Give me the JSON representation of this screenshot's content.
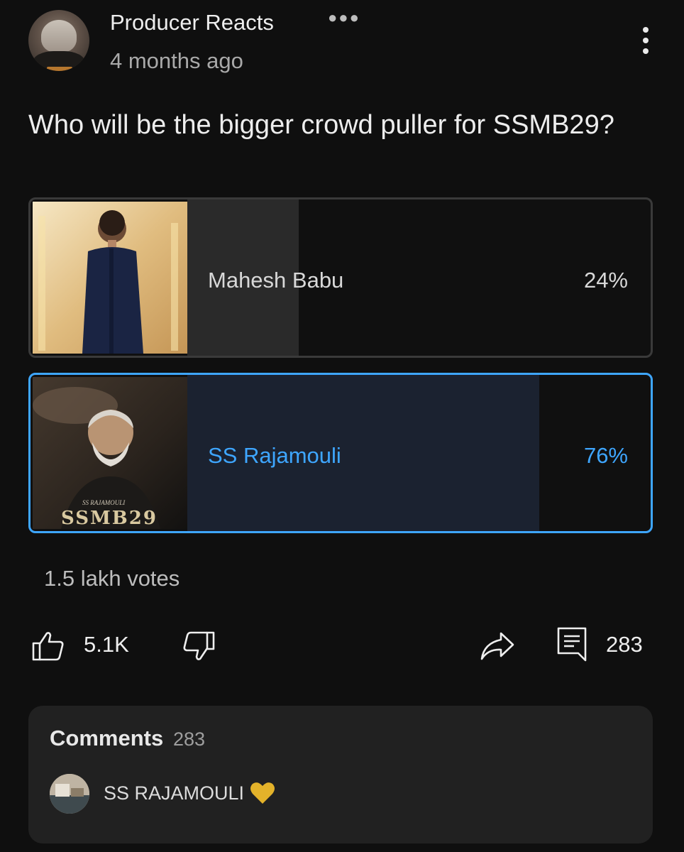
{
  "post": {
    "channel_name": "Producer Reacts",
    "timestamp": "4 months ago",
    "question": "Who will be the bigger crowd puller for SSMB29?"
  },
  "poll": {
    "options": [
      {
        "label": "Mahesh Babu",
        "percent_text": "24%",
        "fraction": 0.24,
        "selected": false
      },
      {
        "label": "SS Rajamouli",
        "percent_text": "76%",
        "fraction": 0.76,
        "selected": true,
        "thumb_caption": "SSMB29",
        "thumb_small_text": "SS RAJAMOULI"
      }
    ],
    "votes": "1.5 lakh votes"
  },
  "actions": {
    "likes": "5.1K",
    "comments": "283",
    "like_icon": "thumb-up-icon",
    "dislike_icon": "thumb-down-icon",
    "share_icon": "share-icon",
    "comment_icon": "comment-icon"
  },
  "comments": {
    "title": "Comments",
    "count": "283",
    "top_comment": {
      "text": "SS RAJAMOULI",
      "emoji": "yellow-heart-icon"
    }
  },
  "colors": {
    "background": "#0f0f0f",
    "accent": "#3ea6ff",
    "card": "#212121"
  }
}
